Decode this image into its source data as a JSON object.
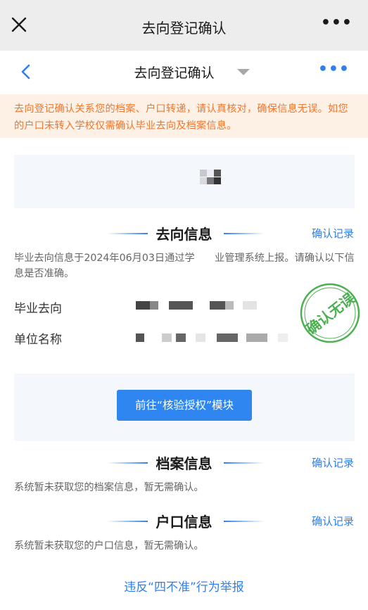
{
  "wechat": {
    "title": "去向登记确认",
    "more": "•••"
  },
  "app": {
    "title": "去向登记确认",
    "more": "•••"
  },
  "notice": {
    "text": "去向登记确认关系您的档案、户口转递，请认真核对，确保信息无误。如您的户口未转入学校仅需确认毕业去向及档案信息。"
  },
  "destination": {
    "title": "去向信息",
    "link": "确认记录",
    "desc": "毕业去向信息于2024年06月03日通过学　　业管理系统上报。请确认以下信息是否准确。",
    "fields": [
      {
        "label": "毕业去向"
      },
      {
        "label": "单位名称"
      }
    ],
    "stamp_text": "确认无误",
    "stamp_color": "#4caf50"
  },
  "auth": {
    "button_label": "前往“核验授权”模块"
  },
  "archive": {
    "title": "档案信息",
    "link": "确认记录",
    "desc": "系统暂未获取您的档案信息，暂无需确认。"
  },
  "hukou": {
    "title": "户口信息",
    "link": "确认记录",
    "desc": "系统暂未获取您的户口信息，暂无需确认。"
  },
  "footer": {
    "report_link": "违反“四不准”行为举报"
  },
  "colors": {
    "accent": "#2f7ff0",
    "notice_bg": "#fdf0e4",
    "notice_text": "#f0772f"
  }
}
